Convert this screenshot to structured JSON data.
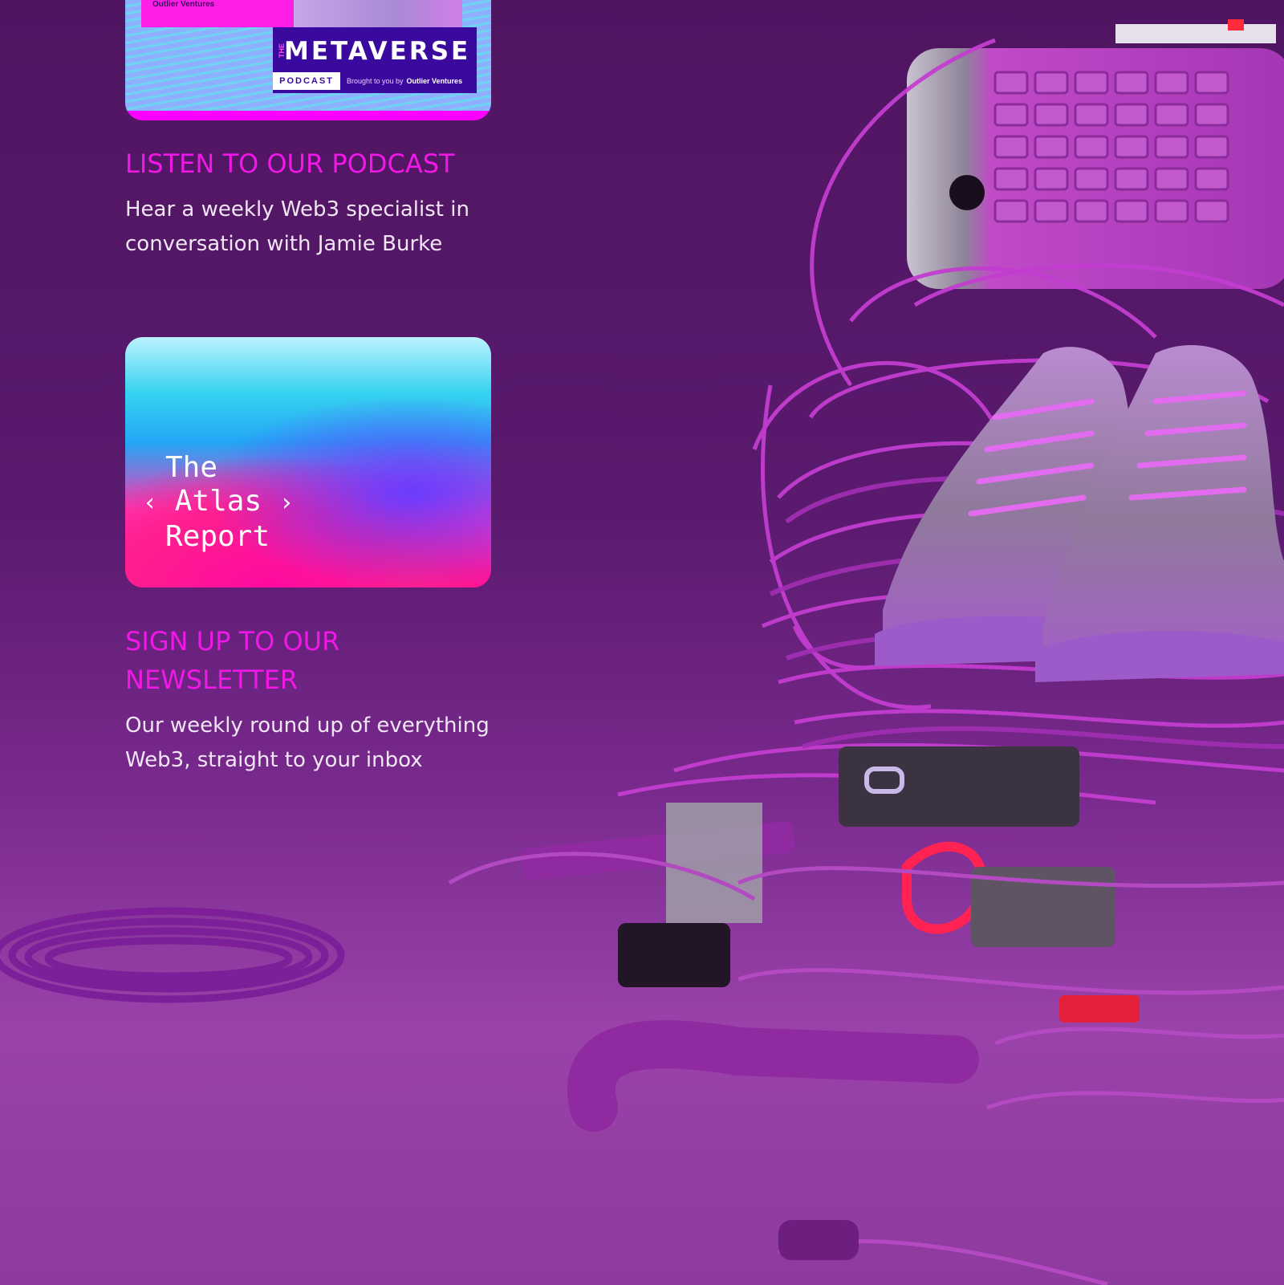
{
  "podcast": {
    "image": {
      "presenter_brand": "Outlier Ventures",
      "title_prefix": "THE",
      "title": "METAVERSE",
      "tag": "PODCAST",
      "brought_by": "Brought to you by",
      "brand": "Outlier Ventures"
    },
    "heading": "LISTEN TO OUR PODCAST",
    "description": "Hear a weekly Web3 specialist in conversation with Jamie Burke"
  },
  "newsletter": {
    "image": {
      "line1": "The",
      "line2": "Atlas",
      "line3": "Report",
      "chevron_left": "‹",
      "chevron_right": "›"
    },
    "heading": "SIGN UP TO OUR NEWSLETTER",
    "description": "Our weekly round up of everything Web3, straight to your inbox"
  },
  "colors": {
    "background": "#521765",
    "heading": "#ef18e6",
    "body_text": "#f1e6f5",
    "accent_magenta": "#ff00ff"
  }
}
